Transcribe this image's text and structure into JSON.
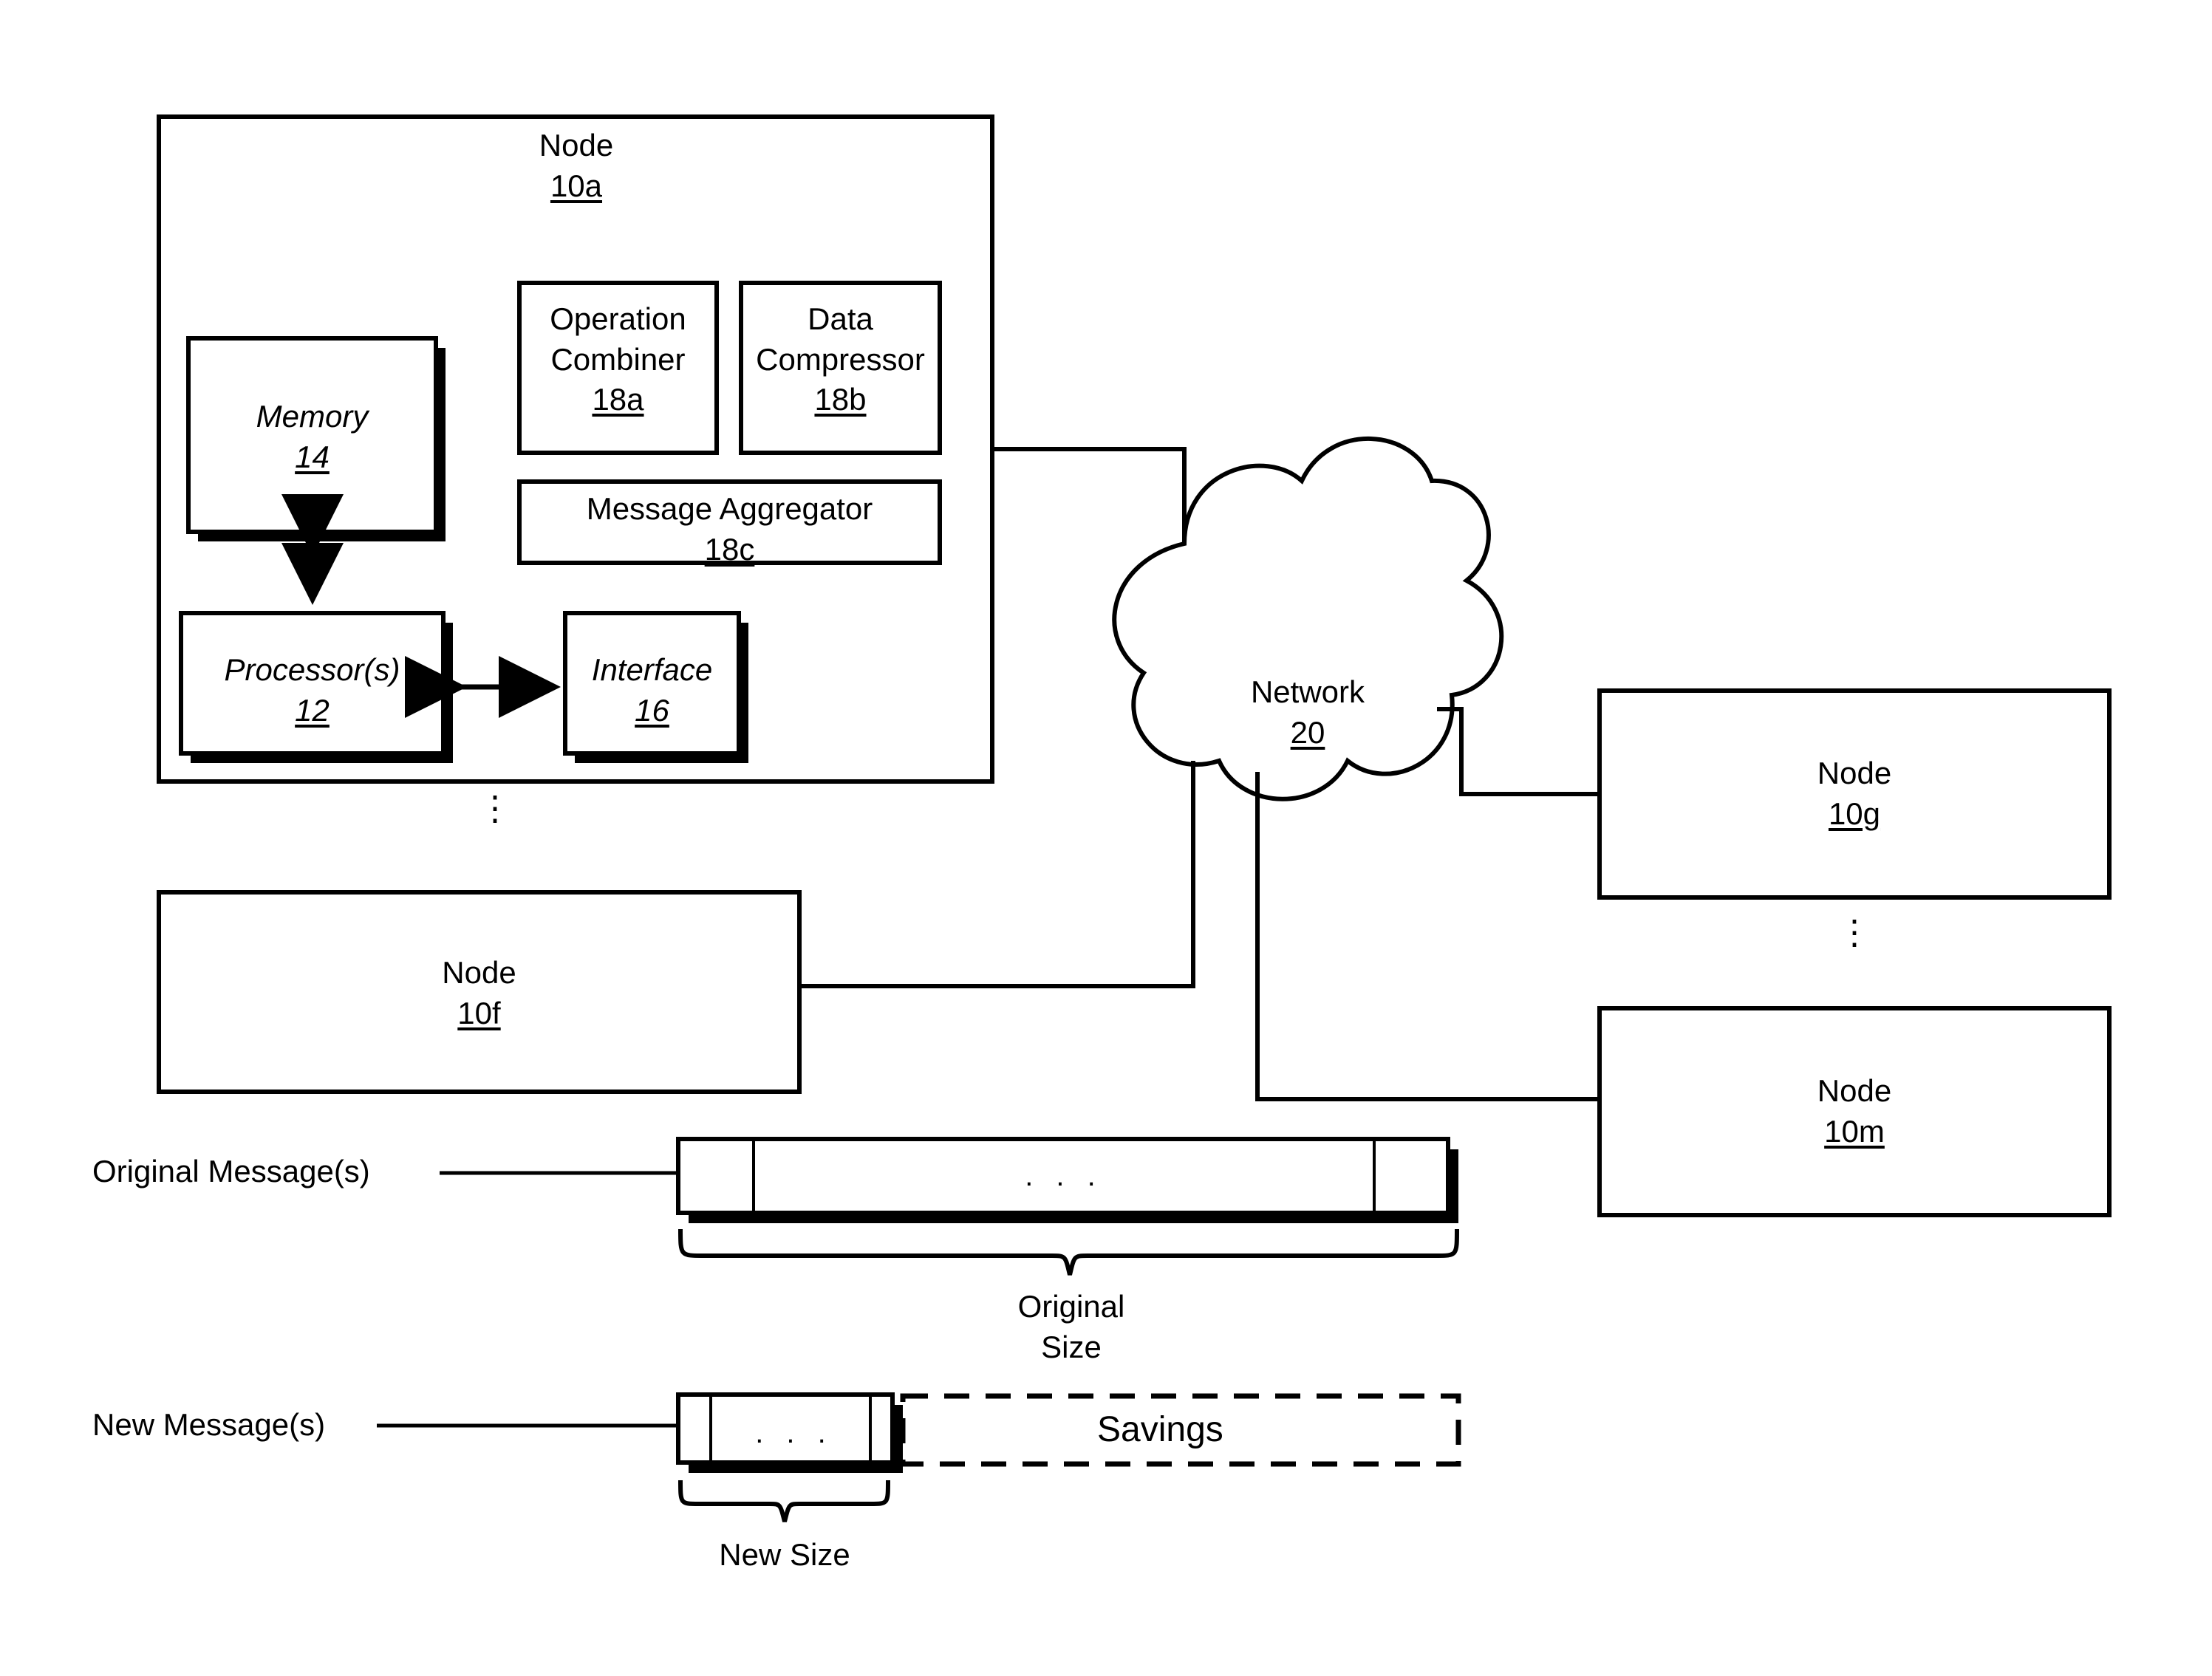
{
  "figure": {
    "type": "patent-block-diagram",
    "background_color": "#ffffff",
    "line_color": "#000000"
  },
  "node_10a": {
    "title": "Node",
    "ref": "10a",
    "components": {
      "memory": {
        "title": "Memory",
        "ref": "14"
      },
      "processor": {
        "title": "Processor(s)",
        "ref": "12"
      },
      "interface": {
        "title": "Interface",
        "ref": "16"
      },
      "operation_combiner": {
        "line1": "Operation",
        "line2": "Combiner",
        "ref": "18a"
      },
      "data_compressor": {
        "line1": "Data",
        "line2": "Compressor",
        "ref": "18b"
      },
      "message_aggregator": {
        "line1": "Message Aggregator",
        "ref": "18c"
      }
    }
  },
  "vertical_ellipsis_left": "⋮",
  "node_10f": {
    "title": "Node",
    "ref": "10f"
  },
  "network": {
    "title": "Network",
    "ref": "20"
  },
  "node_10g": {
    "title": "Node",
    "ref": "10g"
  },
  "vertical_ellipsis_right": "⋮",
  "node_10m": {
    "title": "Node",
    "ref": "10m"
  },
  "messages": {
    "original_label": "Original Message(s)",
    "original_ellipsis": ". . .",
    "original_brace_label_line1": "Original",
    "original_brace_label_line2": "Size",
    "new_label": "New Message(s)",
    "new_ellipsis": ". . .",
    "new_brace_label": "New Size",
    "savings_label": "Savings"
  }
}
